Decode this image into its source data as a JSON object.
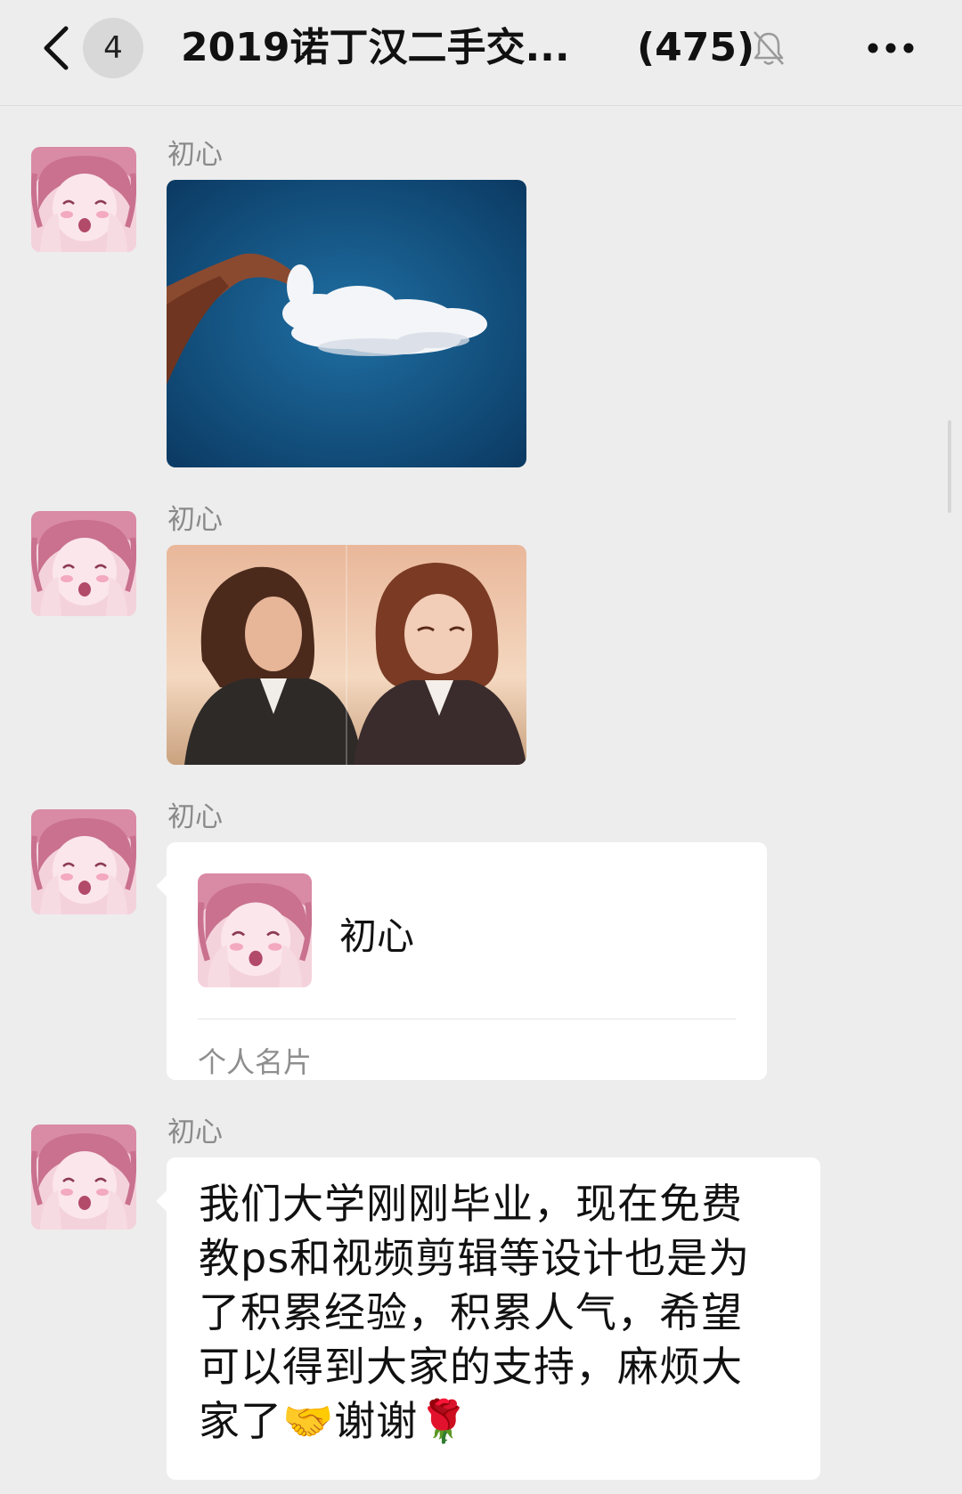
{
  "header": {
    "unread_count": "4",
    "title": "2019诺丁汉二手交...",
    "member_count": "(475)",
    "icons": {
      "back": "chevron-left-icon",
      "mute": "bell-muted-icon",
      "more": "more-dots-icon"
    }
  },
  "messages": [
    {
      "sender": "初心",
      "type": "image",
      "image_desc": "hand-holding-cloud"
    },
    {
      "sender": "初心",
      "type": "image",
      "image_desc": "photo-and-anime-girl"
    },
    {
      "sender": "初心",
      "type": "contact_card",
      "card": {
        "name": "初心",
        "label": "个人名片"
      }
    },
    {
      "sender": "初心",
      "type": "text",
      "text": "我们大学刚刚毕业，现在免费教ps和视频剪辑等设计也是为了积累经验，积累人气，希望可以得到大家的支持，麻烦大家了🤝谢谢🌹"
    }
  ],
  "colors": {
    "background": "#ededed",
    "bubble": "#ffffff",
    "sender_name": "#8a8a8a"
  }
}
